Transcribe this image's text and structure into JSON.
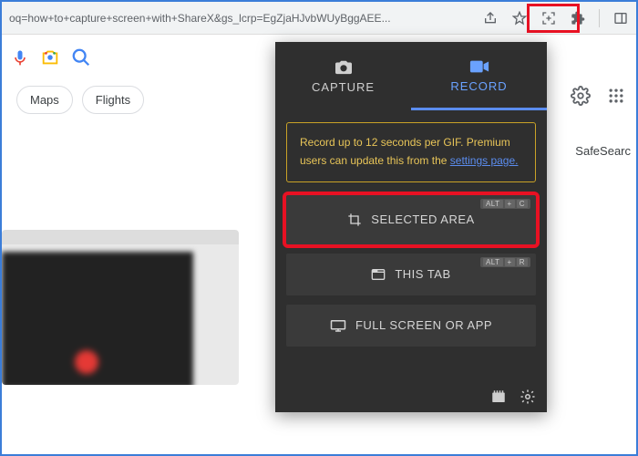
{
  "url": "oq=how+to+capture+screen+with+ShareX&gs_lcrp=EgZjaHJvbWUyBggAEE...",
  "chips": {
    "maps": "Maps",
    "flights": "Flights"
  },
  "safesearch": "SafeSearc",
  "panel": {
    "tabs": {
      "capture": "CAPTURE",
      "record": "RECORD"
    },
    "info_text_1": "Record up to 12 seconds per GIF. Premium users can update this from the ",
    "info_link": "settings page.",
    "actions": {
      "selected": {
        "label": "SELECTED AREA",
        "shortcut_mod": "ALT",
        "shortcut_plus": "+",
        "shortcut_key": "C"
      },
      "tab": {
        "label": "THIS TAB",
        "shortcut_mod": "ALT",
        "shortcut_plus": "+",
        "shortcut_key": "R"
      },
      "full": {
        "label": "FULL SCREEN OR APP"
      }
    }
  }
}
